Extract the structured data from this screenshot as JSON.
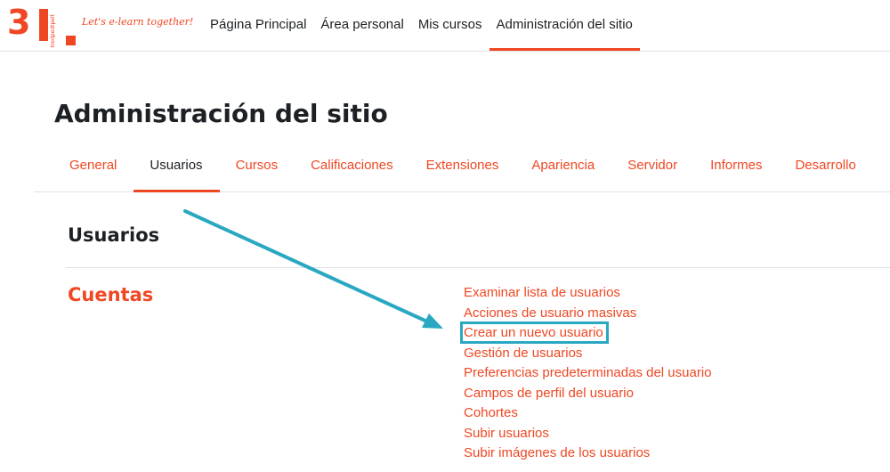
{
  "brand": {
    "logo_number": "3",
    "logo_side_text": "tredpedtpelt",
    "tagline": "Let's e-learn together!"
  },
  "topnav": {
    "items": [
      {
        "label": "Página Principal"
      },
      {
        "label": "Área personal"
      },
      {
        "label": "Mis cursos"
      },
      {
        "label": "Administración del sitio",
        "active": true
      }
    ]
  },
  "page": {
    "title": "Administración del sitio"
  },
  "tabs": [
    {
      "label": "General"
    },
    {
      "label": "Usuarios",
      "active": true
    },
    {
      "label": "Cursos"
    },
    {
      "label": "Calificaciones"
    },
    {
      "label": "Extensiones"
    },
    {
      "label": "Apariencia"
    },
    {
      "label": "Servidor"
    },
    {
      "label": "Informes"
    },
    {
      "label": "Desarrollo"
    }
  ],
  "section": {
    "title": "Usuarios",
    "category": "Cuentas",
    "links": [
      {
        "label": "Examinar lista de usuarios"
      },
      {
        "label": "Acciones de usuario masivas"
      },
      {
        "label": "Crear un nuevo usuario",
        "highlighted": true
      },
      {
        "label": "Gestión de usuarios"
      },
      {
        "label": "Preferencias predeterminadas del usuario"
      },
      {
        "label": "Campos de perfil del usuario"
      },
      {
        "label": "Cohortes"
      },
      {
        "label": "Subir usuarios"
      },
      {
        "label": "Subir imágenes de los usuarios"
      }
    ]
  },
  "annotation": {
    "arrow_color": "#2aa8c2",
    "highlight_color": "#2aa8c2"
  },
  "colors": {
    "accent": "#ef4723",
    "text": "#1d2125"
  }
}
